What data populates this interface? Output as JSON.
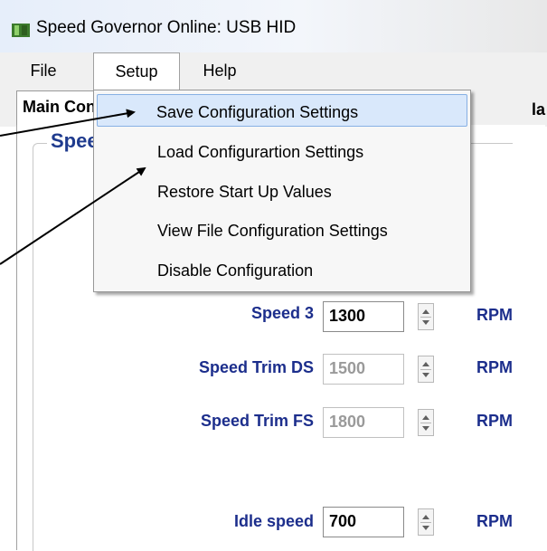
{
  "window": {
    "title": "Speed Governor Online: USB HID"
  },
  "menubar": {
    "file": "File",
    "setup": "Setup",
    "help": "Help"
  },
  "tabs": {
    "main": "Main Configuration",
    "right_partial": "la"
  },
  "group": {
    "title": "Speed Settings"
  },
  "setup_menu": {
    "items": [
      "Save Configuration Settings",
      "Load Configurartion Settings",
      "Restore Start Up Values",
      "View File Configuration Settings",
      "Disable Configuration"
    ],
    "highlighted_index": 0
  },
  "fields": [
    {
      "label": "Speed 3",
      "value": "1300",
      "unit": "RPM",
      "enabled": true
    },
    {
      "label": "Speed Trim DS",
      "value": "1500",
      "unit": "RPM",
      "enabled": false
    },
    {
      "label": "Speed Trim FS",
      "value": "1800",
      "unit": "RPM",
      "enabled": false
    },
    {
      "label": "Idle speed",
      "value": "700",
      "unit": "RPM",
      "enabled": true
    }
  ],
  "colors": {
    "label_blue": "#1c2e8c",
    "highlight": "#d9e8fb"
  }
}
